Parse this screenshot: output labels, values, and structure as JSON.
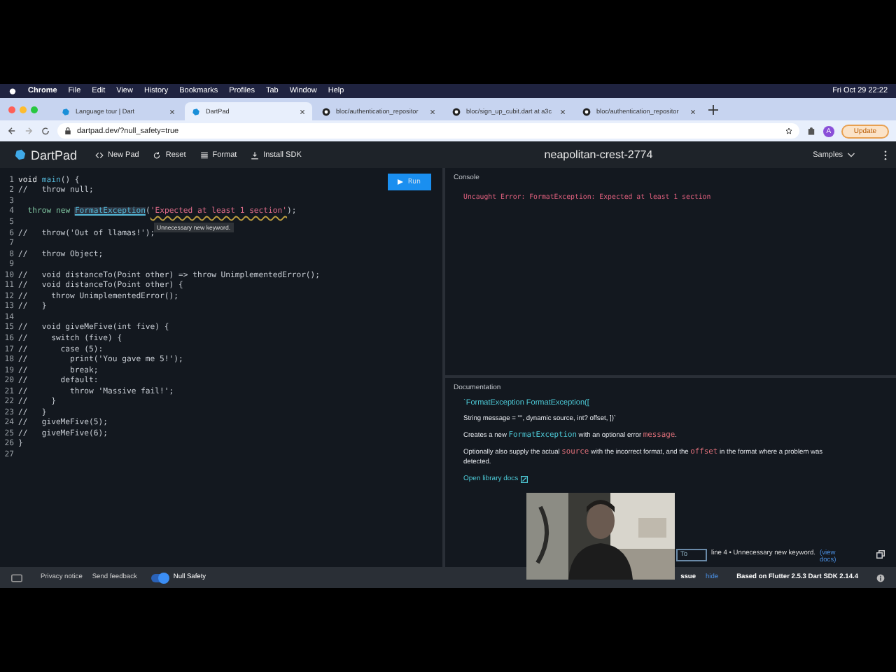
{
  "menu_bar": {
    "app": "Chrome",
    "items": [
      "File",
      "Edit",
      "View",
      "History",
      "Bookmarks",
      "Profiles",
      "Tab",
      "Window",
      "Help"
    ],
    "clock": "Fri Oct 29  22:22"
  },
  "browser_tabs": [
    {
      "title": "Language tour | Dart",
      "selected": false,
      "kind": "dart"
    },
    {
      "title": "DartPad",
      "selected": true,
      "kind": "dart"
    },
    {
      "title": "bloc/authentication_repositor",
      "selected": false,
      "kind": "github"
    },
    {
      "title": "bloc/sign_up_cubit.dart at a3c",
      "selected": false,
      "kind": "github"
    },
    {
      "title": "bloc/authentication_repositor",
      "selected": false,
      "kind": "github"
    }
  ],
  "address": "dartpad.dev/?null_safety=true",
  "profile_initial": "A",
  "update_button": "Update",
  "app_header": {
    "logo": "DartPad",
    "actions": [
      {
        "label": "New Pad",
        "kind": "code"
      },
      {
        "label": "Reset",
        "kind": "reset"
      },
      {
        "label": "Format",
        "kind": "format"
      },
      {
        "label": "Install SDK",
        "kind": "download"
      }
    ],
    "pad_name": "neapolitan-crest-2774",
    "samples": "Samples"
  },
  "run_button": "Run",
  "code_lines": [
    {
      "number": "1",
      "segments": [
        {
          "text": "void ",
          "kind": "keyword"
        },
        {
          "text": "main",
          "kind": "function"
        },
        {
          "text": "() {",
          "kind": "plain"
        }
      ]
    },
    {
      "number": "2",
      "segments": [
        {
          "text": "//   throw null;",
          "kind": "plain"
        }
      ]
    },
    {
      "number": "3"
    },
    {
      "number": "4",
      "segments": [
        {
          "text": "  throw ",
          "kind": "keyword2"
        },
        {
          "text": "new ",
          "kind": "keyword2"
        },
        {
          "text": "FormatException",
          "kind": "class"
        },
        {
          "text": "(",
          "kind": "plain"
        },
        {
          "text": "'Expected at least 1 section'",
          "kind": "string"
        },
        {
          "text": ");",
          "kind": "plain"
        }
      ]
    },
    {
      "number": "5"
    },
    {
      "number": "6",
      "segments": [
        {
          "text": "//   throw('Out of llamas!');",
          "kind": "plain"
        }
      ]
    },
    {
      "number": "7"
    },
    {
      "number": "8",
      "segments": [
        {
          "text": "//   throw Object;",
          "kind": "plain"
        }
      ]
    },
    {
      "number": "9"
    },
    {
      "number": "10",
      "segments": [
        {
          "text": "//   void distanceTo(Point other) => throw UnimplementedError();",
          "kind": "plain"
        }
      ]
    },
    {
      "number": "11",
      "segments": [
        {
          "text": "//   void distanceTo(Point other) {",
          "kind": "plain"
        }
      ]
    },
    {
      "number": "12",
      "segments": [
        {
          "text": "//     throw UnimplementedError();",
          "kind": "plain"
        }
      ]
    },
    {
      "number": "13",
      "segments": [
        {
          "text": "//   }",
          "kind": "plain"
        }
      ]
    },
    {
      "number": "14"
    },
    {
      "number": "15",
      "segments": [
        {
          "text": "//   void giveMeFive(int five) {",
          "kind": "plain"
        }
      ]
    },
    {
      "number": "16",
      "segments": [
        {
          "text": "//     switch (five) {",
          "kind": "plain"
        }
      ]
    },
    {
      "number": "17",
      "segments": [
        {
          "text": "//       case (5):",
          "kind": "plain"
        }
      ]
    },
    {
      "number": "18",
      "segments": [
        {
          "text": "//         print('You gave me 5!');",
          "kind": "plain"
        }
      ]
    },
    {
      "number": "19",
      "segments": [
        {
          "text": "//         break;",
          "kind": "plain"
        }
      ]
    },
    {
      "number": "20",
      "segments": [
        {
          "text": "//       default:",
          "kind": "plain"
        }
      ]
    },
    {
      "number": "21",
      "segments": [
        {
          "text": "//         throw 'Massive fail!';",
          "kind": "plain"
        }
      ]
    },
    {
      "number": "22",
      "segments": [
        {
          "text": "//     }",
          "kind": "plain"
        }
      ]
    },
    {
      "number": "23",
      "segments": [
        {
          "text": "//   }",
          "kind": "plain"
        }
      ]
    },
    {
      "number": "24",
      "segments": [
        {
          "text": "//   giveMeFive(5);",
          "kind": "plain"
        }
      ]
    },
    {
      "number": "25",
      "segments": [
        {
          "text": "//   giveMeFive(6);",
          "kind": "plain"
        }
      ]
    },
    {
      "number": "26",
      "segments": [
        {
          "text": "}",
          "kind": "plain"
        }
      ]
    },
    {
      "number": "27"
    }
  ],
  "tooltip": "Unnecessary new keyword.",
  "console": {
    "label": "Console",
    "output": "Uncaught Error: FormatException: Expected at least 1 section"
  },
  "documentation": {
    "label": "Documentation",
    "signature": "`FormatException FormatException([",
    "params": "String message = \"\", dynamic source, int? offset, ])`",
    "paragraphs": [
      [
        {
          "text": "Creates a new ",
          "kind": "text"
        },
        {
          "text": "FormatException",
          "kind": "type"
        },
        {
          "text": " with an optional error ",
          "kind": "text"
        },
        {
          "text": "message",
          "kind": "param"
        },
        {
          "text": ".",
          "kind": "text"
        }
      ],
      [
        {
          "text": "Optionally also supply the actual ",
          "kind": "text"
        },
        {
          "text": "source",
          "kind": "param"
        },
        {
          "text": " with the incorrect format, and the ",
          "kind": "text"
        },
        {
          "text": "offset",
          "kind": "param"
        },
        {
          "text": " in the format where a problem was detected.",
          "kind": "text"
        }
      ]
    ],
    "link": "Open library docs"
  },
  "issue": {
    "quick_fix": "To",
    "message": "line 4 • Unnecessary new keyword.",
    "view_docs": "(view docs)"
  },
  "footer": {
    "privacy": "Privacy notice",
    "feedback": "Send feedback",
    "null_safety": {
      "label": "Null Safety",
      "on": true
    },
    "issue_tail": "ssue",
    "hide": "hide",
    "version": "Based on Flutter 2.5.3 Dart SDK 2.14.4"
  }
}
